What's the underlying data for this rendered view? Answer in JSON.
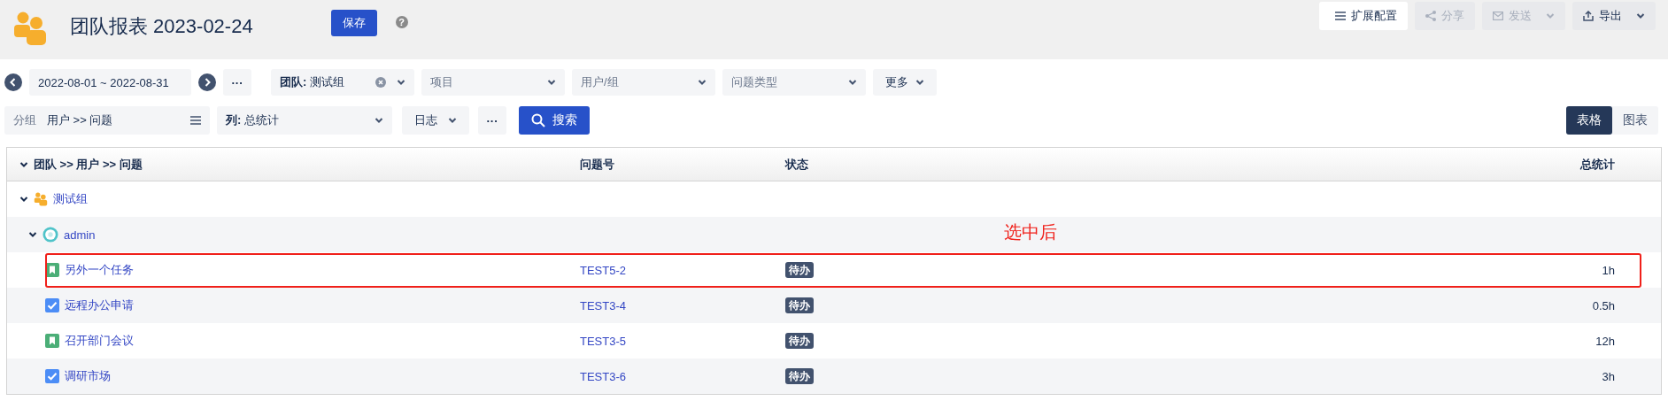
{
  "header": {
    "title": "团队报表 2023-02-24",
    "save": "保存",
    "help": "?"
  },
  "actions": [
    {
      "kind": "config",
      "label": "扩展配置",
      "disabled": false,
      "dropdown": false
    },
    {
      "kind": "share",
      "label": "分享",
      "disabled": true,
      "dropdown": false
    },
    {
      "kind": "send",
      "label": "发送",
      "disabled": true,
      "dropdown": true
    },
    {
      "kind": "export",
      "label": "导出",
      "disabled": false,
      "dropdown": true
    }
  ],
  "filters": {
    "date_range": "2022-08-01 ~ 2022-08-31",
    "dots": "···",
    "selects": [
      {
        "value": "**团队:** 测试组",
        "clearable": true
      },
      {
        "placeholder": "项目"
      },
      {
        "placeholder": "用户/组"
      },
      {
        "placeholder": "问题类型"
      }
    ],
    "more": "更多"
  },
  "toolbar": {
    "group_label": "分组",
    "group_value": "用户 >> 问题",
    "columns": "**列:** 总统计",
    "log": "日志",
    "dots": "···",
    "search": "搜索"
  },
  "view_tabs": [
    {
      "label": "表格",
      "selected": true
    },
    {
      "label": "图表",
      "selected": false
    }
  ],
  "table": {
    "columns": [
      "团队 >> 用户 >> 问题",
      "问题号",
      "状态",
      "总统计"
    ],
    "rows": [
      {
        "kind": "team",
        "name": "测试组",
        "expanded": true,
        "children": [
          {
            "kind": "user",
            "name": "admin",
            "expanded": true,
            "children": [
              {
                "kind": "story",
                "name": "另外一个任务",
                "key": "TEST5-2",
                "status": "待办",
                "total": "1h",
                "highlighted": true
              },
              {
                "kind": "task",
                "name": "远程办公申请",
                "key": "TEST3-4",
                "status": "待办",
                "total": "0.5h",
                "highlighted": false
              },
              {
                "kind": "story",
                "name": "召开部门会议",
                "key": "TEST3-5",
                "status": "待办",
                "total": "12h",
                "highlighted": false
              },
              {
                "kind": "task",
                "name": "调研市场",
                "key": "TEST3-6",
                "status": "待办",
                "total": "3h",
                "highlighted": false
              }
            ]
          }
        ]
      }
    ]
  },
  "annotation": {
    "text": "选中后"
  }
}
